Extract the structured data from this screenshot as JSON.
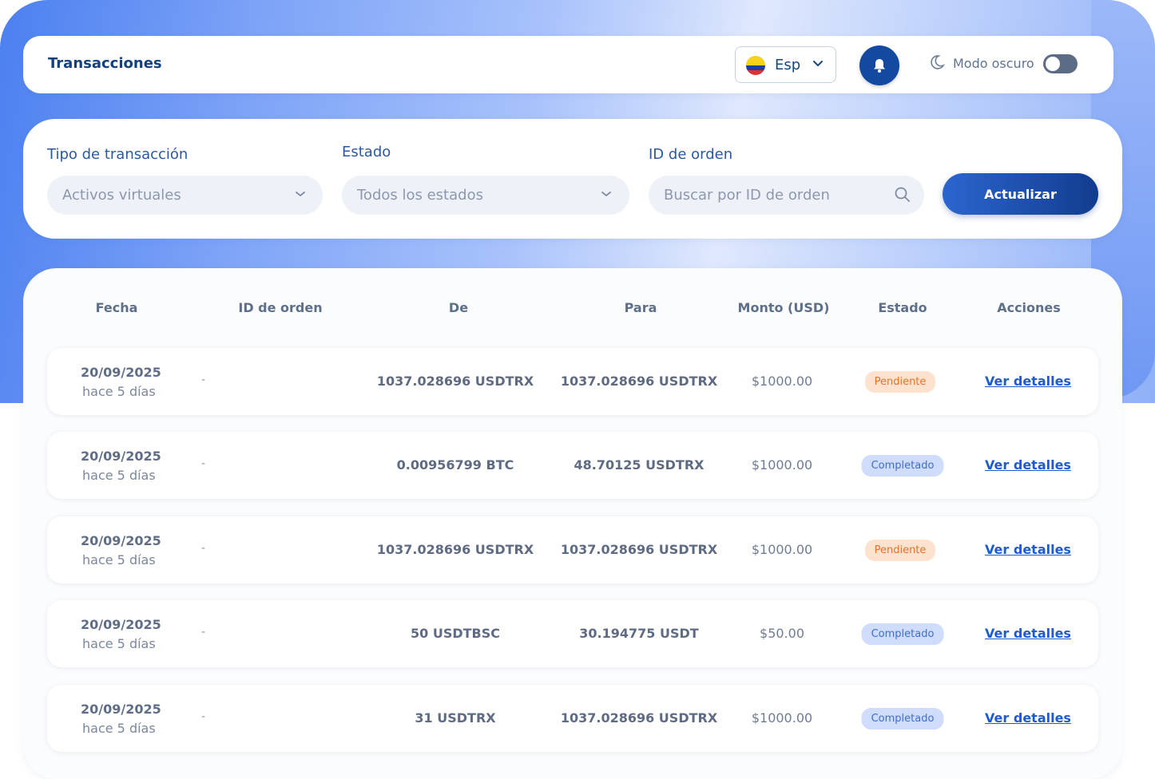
{
  "header": {
    "title": "Transacciones",
    "language": "Esp",
    "dark_mode_label": "Modo oscuro",
    "dark_mode_on": false
  },
  "filters": {
    "type_label": "Tipo de transacción",
    "type_value": "Activos virtuales",
    "status_label": "Estado",
    "status_value": "Todos los estados",
    "order_label": "ID de orden",
    "order_placeholder": "Buscar por ID de orden",
    "update_button": "Actualizar"
  },
  "table": {
    "columns": [
      "Fecha",
      "ID de orden",
      "De",
      "Para",
      "Monto (USD)",
      "Estado",
      "Acciones"
    ],
    "rows": [
      {
        "date": "20/09/2025",
        "ago": "hace 5 días",
        "order_id": "-",
        "from": "1037.028696 USDTRX",
        "to": "1037.028696 USDTRX",
        "amount": "$1000.00",
        "status": "Pendiente",
        "status_kind": "pending",
        "action": "Ver detalles"
      },
      {
        "date": "20/09/2025",
        "ago": "hace 5 días",
        "order_id": "-",
        "from": "0.00956799 BTC",
        "to": "48.70125 USDTRX",
        "amount": "$1000.00",
        "status": "Completado",
        "status_kind": "completed",
        "action": "Ver detalles"
      },
      {
        "date": "20/09/2025",
        "ago": "hace 5 días",
        "order_id": "-",
        "from": "1037.028696 USDTRX",
        "to": "1037.028696 USDTRX",
        "amount": "$1000.00",
        "status": "Pendiente",
        "status_kind": "pending",
        "action": "Ver detalles"
      },
      {
        "date": "20/09/2025",
        "ago": "hace 5 días",
        "order_id": "-",
        "from": "50 USDTBSC",
        "to": "30.194775 USDT",
        "amount": "$50.00",
        "status": "Completado",
        "status_kind": "completed",
        "action": "Ver detalles"
      },
      {
        "date": "20/09/2025",
        "ago": "hace 5 días",
        "order_id": "-",
        "from": "31 USDTRX",
        "to": "1037.028696 USDTRX",
        "amount": "$1000.00",
        "status": "Completado",
        "status_kind": "completed",
        "action": "Ver detalles"
      }
    ]
  },
  "colors": {
    "primary": "#134aa0",
    "pending_bg": "#fde3cf",
    "pending_text": "#e8712a",
    "completed_bg": "#cfdcfb",
    "completed_text": "#3d6ed1"
  }
}
